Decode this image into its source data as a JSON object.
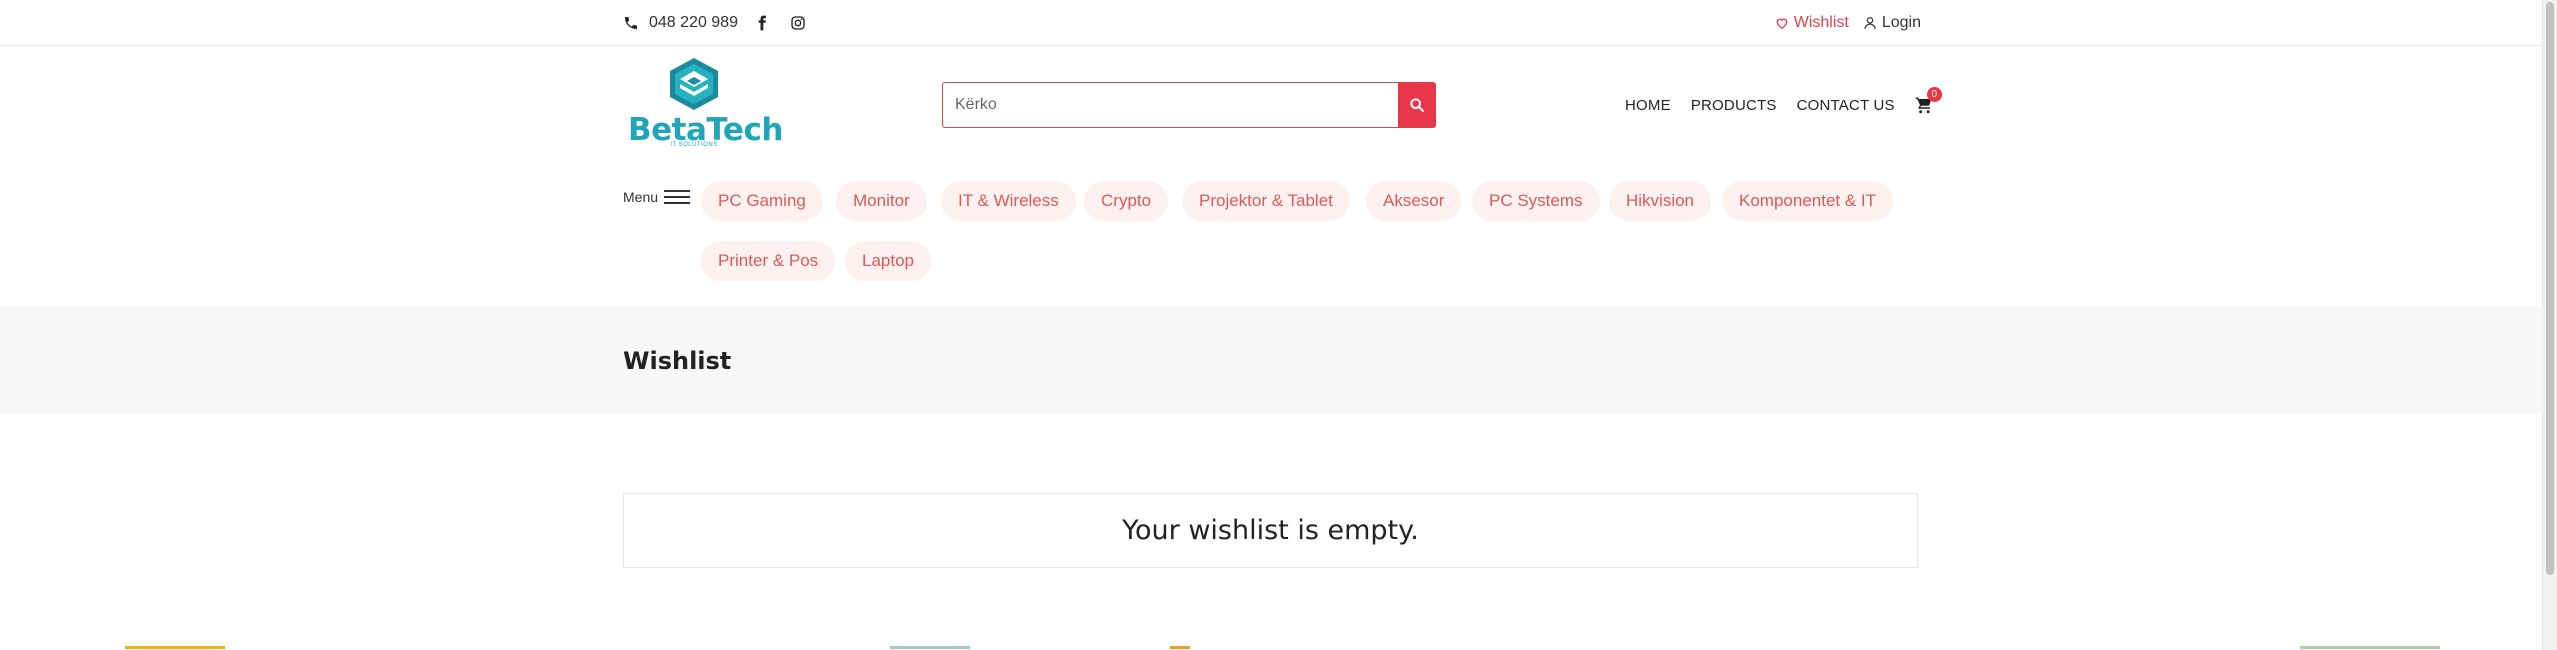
{
  "topbar": {
    "phone": "048 220 989",
    "wishlist_link": "Wishlist",
    "login_link": "Login"
  },
  "logo": {
    "brand": "BetaTech",
    "tagline": "IT SOLUTIONS"
  },
  "search": {
    "placeholder": "Kërko"
  },
  "nav": {
    "items": [
      "HOME",
      "PRODUCTS",
      "CONTACT US"
    ],
    "cart_count": "0"
  },
  "menu_label": "Menu",
  "categories": [
    "PC Gaming",
    "Monitor",
    "IT & Wireless",
    "Crypto",
    "Projektor & Tablet",
    "Aksesor",
    "PC Systems",
    "Hikvision",
    "Komponentet & IT",
    "Printer & Pos",
    "Laptop"
  ],
  "page": {
    "title": "Wishlist",
    "empty_message": "Your wishlist is empty."
  },
  "colors": {
    "accent": "#e8374a",
    "brand": "#1fa7b9",
    "pill_bg": "#fdf1ef",
    "pill_text": "#d95a5a",
    "header_bg": "#f6f7f9"
  },
  "icons": {
    "phone": "phone-icon",
    "facebook": "facebook-icon",
    "instagram": "instagram-icon",
    "wishlist": "heart-icon",
    "login": "user-icon",
    "search": "search-icon",
    "cart": "cart-icon",
    "menu": "hamburger-icon"
  }
}
